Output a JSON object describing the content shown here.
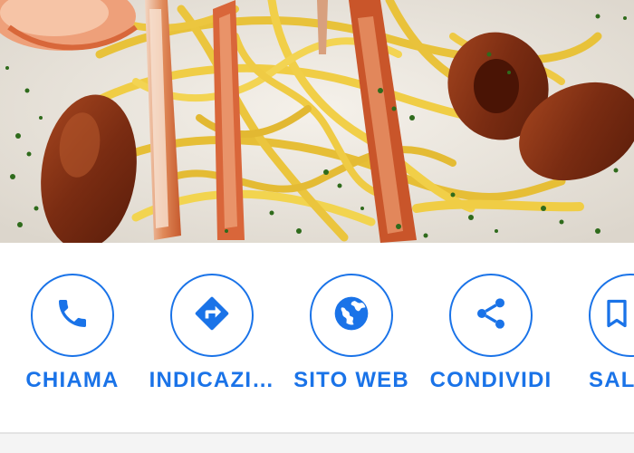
{
  "actions": [
    {
      "label": "CHIAMA",
      "icon": "phone-icon"
    },
    {
      "label": "INDICAZI…",
      "icon": "directions-icon"
    },
    {
      "label": "SITO WEB",
      "icon": "globe-icon"
    },
    {
      "label": "CONDIVIDI",
      "icon": "share-icon"
    },
    {
      "label": "SAL",
      "icon": "bookmark-icon"
    }
  ],
  "colors": {
    "accent": "#1a73e8",
    "divider": "#e3e3e3",
    "background": "#ffffff"
  }
}
